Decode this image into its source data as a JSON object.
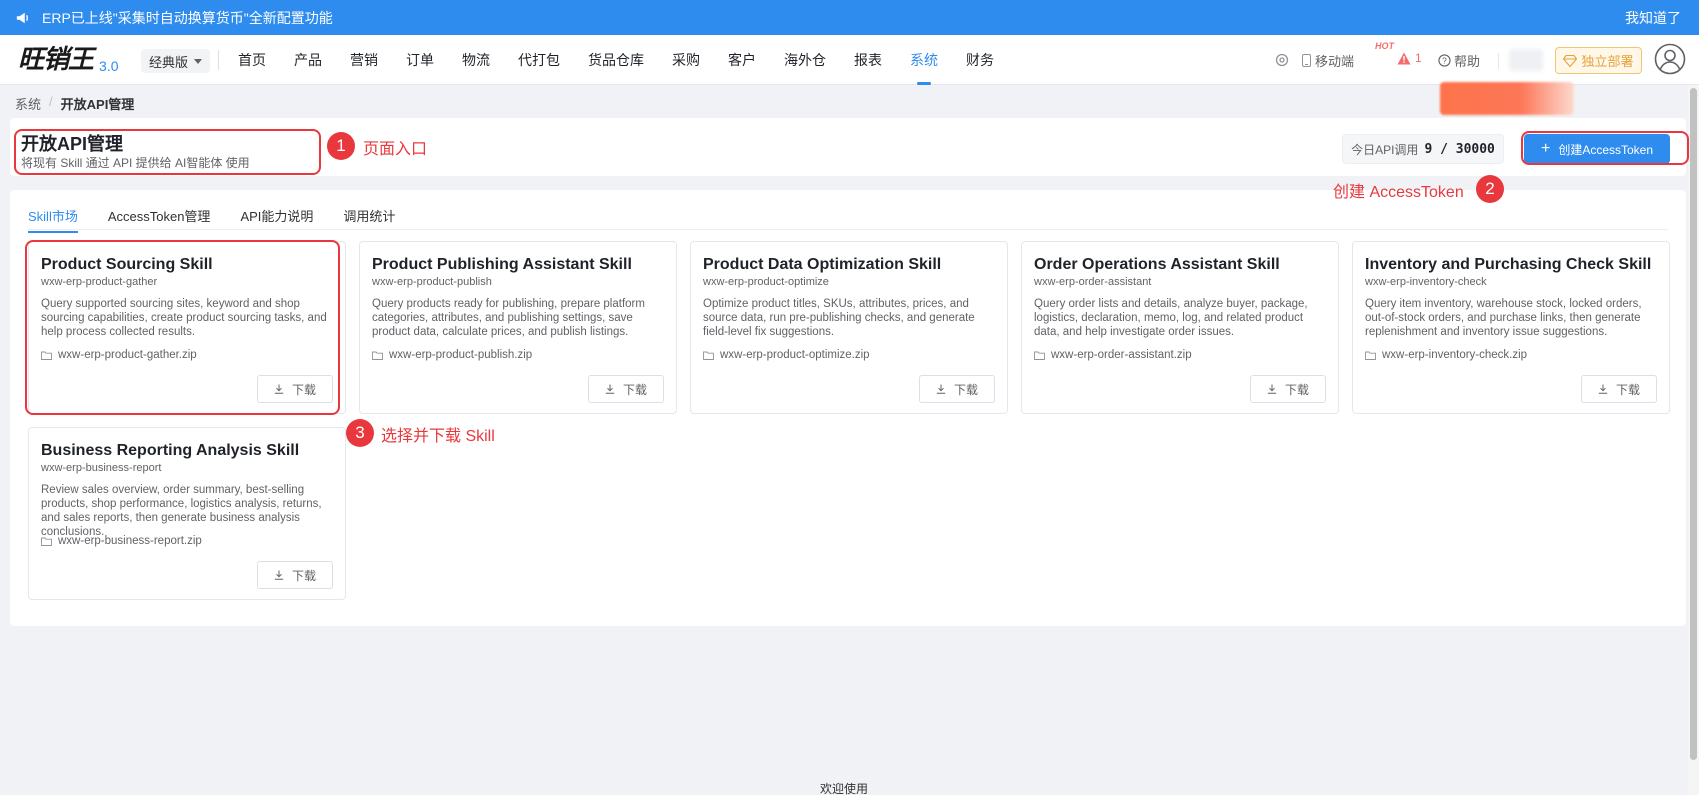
{
  "announcement": {
    "text": "ERP已上线\"采集时自动换算货币\"全新配置功能",
    "dismiss": "我知道了"
  },
  "nav": {
    "logo_text": "旺销王",
    "logo_version": "3.0",
    "edition": "经典版",
    "menu": [
      "首页",
      "产品",
      "营销",
      "订单",
      "物流",
      "代打包",
      "货品仓库",
      "采购",
      "客户",
      "海外仓",
      "报表",
      "系统",
      "财务"
    ],
    "active_menu": "系统",
    "mobile": "移动端",
    "hot": "HOT",
    "warn_count": "1",
    "help": "帮助",
    "deploy": "独立部署"
  },
  "breadcrumb": [
    "系统",
    "开放API管理"
  ],
  "header": {
    "title": "开放API管理",
    "subtitle": "将现有 Skill 通过 API 提供给 AI智能体 使用",
    "usage_label": "今日API调用",
    "usage_count": "9 / 30000",
    "create_button": "创建AccessToken"
  },
  "tabs": [
    "Skill市场",
    "AccessToken管理",
    "API能力说明",
    "调用统计"
  ],
  "active_tab": 0,
  "download_label": "下载",
  "skills": [
    {
      "title": "Product Sourcing Skill",
      "slug": "wxw-erp-product-gather",
      "description": "Query supported sourcing sites, keyword and shop sourcing capabilities, create product sourcing tasks, and help process collected results.",
      "file": "wxw-erp-product-gather.zip"
    },
    {
      "title": "Product Publishing Assistant Skill",
      "slug": "wxw-erp-product-publish",
      "description": "Query products ready for publishing, prepare platform categories, attributes, and publishing settings, save product data, calculate prices, and publish listings.",
      "file": "wxw-erp-product-publish.zip"
    },
    {
      "title": "Product Data Optimization Skill",
      "slug": "wxw-erp-product-optimize",
      "description": "Optimize product titles, SKUs, attributes, prices, and source data, run pre-publishing checks, and generate field-level fix suggestions.",
      "file": "wxw-erp-product-optimize.zip"
    },
    {
      "title": "Order Operations Assistant Skill",
      "slug": "wxw-erp-order-assistant",
      "description": "Query order lists and details, analyze buyer, package, logistics, declaration, memo, log, and related product data, and help investigate order issues.",
      "file": "wxw-erp-order-assistant.zip"
    },
    {
      "title": "Inventory and Purchasing Check Skill",
      "slug": "wxw-erp-inventory-check",
      "description": "Query item inventory, warehouse stock, locked orders, out-of-stock orders, and purchase links, then generate replenishment and inventory issue suggestions.",
      "file": "wxw-erp-inventory-check.zip"
    },
    {
      "title": "Business Reporting Analysis Skill",
      "slug": "wxw-erp-business-report",
      "description": "Review sales overview, order summary, best-selling products, shop performance, logistics analysis, returns, and sales reports, then generate business analysis conclusions.",
      "file": "wxw-erp-business-report.zip"
    }
  ],
  "annotations": [
    {
      "num": "1",
      "text": "页面入口"
    },
    {
      "num": "2",
      "text": "创建 AccessToken"
    },
    {
      "num": "3",
      "text": "选择并下载 Skill"
    }
  ],
  "footer": "欢迎使用",
  "colors": {
    "primary": "#2f8cef",
    "annotation": "#e8383d",
    "deploy": "#e6a23c"
  }
}
